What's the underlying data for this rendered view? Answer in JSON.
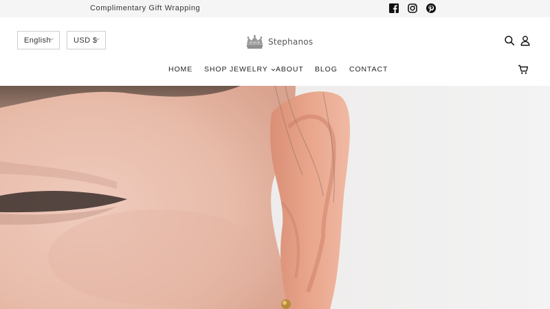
{
  "announcement": {
    "text": "Complimentary Gift Wrapping",
    "social": [
      "facebook-icon",
      "instagram-icon",
      "pinterest-icon"
    ]
  },
  "header": {
    "language": {
      "selected": "English"
    },
    "currency": {
      "selected": "USD $"
    },
    "logo": {
      "text": "Stephanos",
      "icon": "crown-icon"
    },
    "icons": [
      "search-icon",
      "account-icon",
      "cart-icon"
    ]
  },
  "nav": {
    "items": [
      {
        "label": "HOME"
      },
      {
        "label": "SHOP JEWELRY",
        "has_dropdown": true
      },
      {
        "label": "ABOUT"
      },
      {
        "label": "BLOG"
      },
      {
        "label": "CONTACT"
      }
    ]
  },
  "hero": {
    "image": "close-up of a woman's ear wearing a small gold stud earring"
  },
  "colors": {
    "announcement_bg": "#f5f5f5",
    "text": "#222222",
    "border": "#cfcfcf"
  }
}
